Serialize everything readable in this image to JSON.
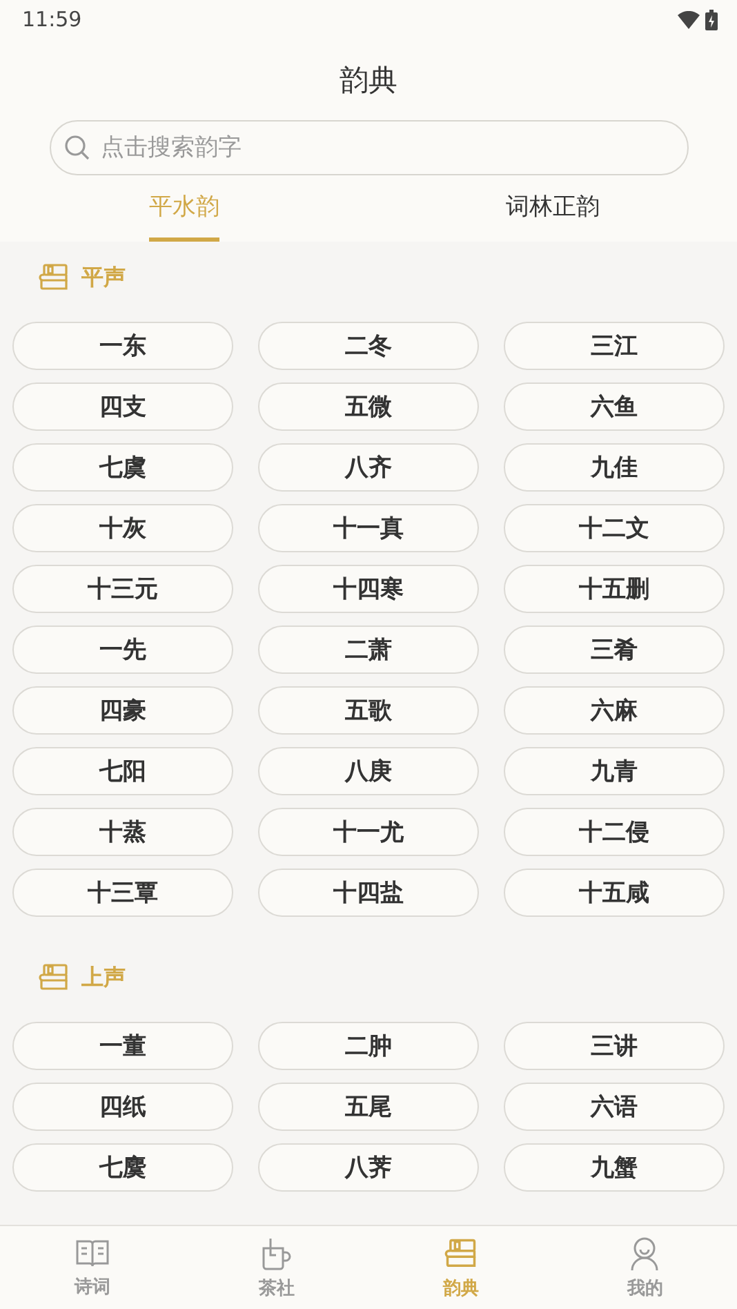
{
  "status_bar": {
    "time": "11:59"
  },
  "header": {
    "title": "韵典"
  },
  "search": {
    "placeholder": "点击搜索韵字"
  },
  "tabs": [
    {
      "label": "平水韵",
      "selected": true
    },
    {
      "label": "词林正韵",
      "selected": false
    }
  ],
  "sections": [
    {
      "title": "平声",
      "rhymes": [
        "一东",
        "二冬",
        "三江",
        "四支",
        "五微",
        "六鱼",
        "七虞",
        "八齐",
        "九佳",
        "十灰",
        "十一真",
        "十二文",
        "十三元",
        "十四寒",
        "十五删",
        "一先",
        "二萧",
        "三肴",
        "四豪",
        "五歌",
        "六麻",
        "七阳",
        "八庚",
        "九青",
        "十蒸",
        "十一尤",
        "十二侵",
        "十三覃",
        "十四盐",
        "十五咸"
      ]
    },
    {
      "title": "上声",
      "rhymes": [
        "一董",
        "二肿",
        "三讲",
        "四纸",
        "五尾",
        "六语",
        "七麌",
        "八荠",
        "九蟹"
      ]
    }
  ],
  "bottom_nav": [
    {
      "label": "诗词",
      "selected": false
    },
    {
      "label": "茶社",
      "selected": false
    },
    {
      "label": "韵典",
      "selected": true
    },
    {
      "label": "我的",
      "selected": false
    }
  ]
}
